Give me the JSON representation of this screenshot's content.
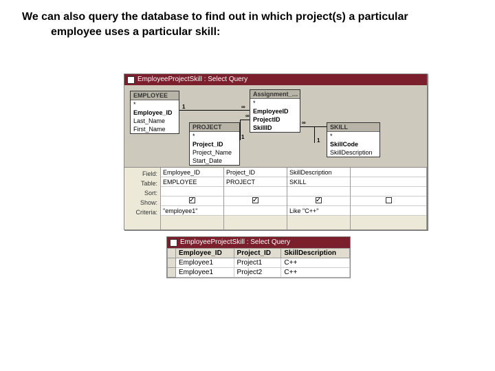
{
  "heading_line1": "We can also query the database to find out in which project(s) a particular",
  "heading_line2": "employee uses a particular skill:",
  "designWindowTitle": "EmployeeProjectSkill : Select Query",
  "tables": {
    "employee": {
      "name": "EMPLOYEE",
      "f0": "*",
      "f1": "Employee_ID",
      "f2": "Last_Name",
      "f3": "First_Name"
    },
    "project": {
      "name": "PROJECT",
      "f0": "*",
      "f1": "Project_ID",
      "f2": "Project_Name",
      "f3": "Start_Date"
    },
    "assignment": {
      "name": "Assignment_…",
      "f0": "*",
      "f1": "EmployeeID",
      "f2": "ProjectID",
      "f3": "SkillID"
    },
    "skill": {
      "name": "SKILL",
      "f0": "*",
      "f1": "SkillCode",
      "f2": "SkillDescription"
    }
  },
  "joins": {
    "one": "1",
    "many": "∞"
  },
  "gridLabels": {
    "field": "Field:",
    "table": "Table:",
    "sort": "Sort:",
    "show": "Show:",
    "criteria": "Criteria:"
  },
  "gridCols": [
    {
      "field": "Employee_ID",
      "table": "EMPLOYEE",
      "show": true,
      "criteria": "\"employee1\""
    },
    {
      "field": "Project_ID",
      "table": "PROJECT",
      "show": true,
      "criteria": ""
    },
    {
      "field": "SkillDescription",
      "table": "SKILL",
      "show": true,
      "criteria": "Like \"C++\""
    },
    {
      "field": "",
      "table": "",
      "show": false,
      "criteria": ""
    }
  ],
  "resultWindowTitle": "EmployeeProjectSkill : Select Query",
  "resultCols": {
    "c0": "Employee_ID",
    "c1": "Project_ID",
    "c2": "SkillDescription"
  },
  "resultRows": [
    {
      "c0": "Employee1",
      "c1": "Project1",
      "c2": "C++"
    },
    {
      "c0": "Employee1",
      "c1": "Project2",
      "c2": "C++"
    }
  ]
}
